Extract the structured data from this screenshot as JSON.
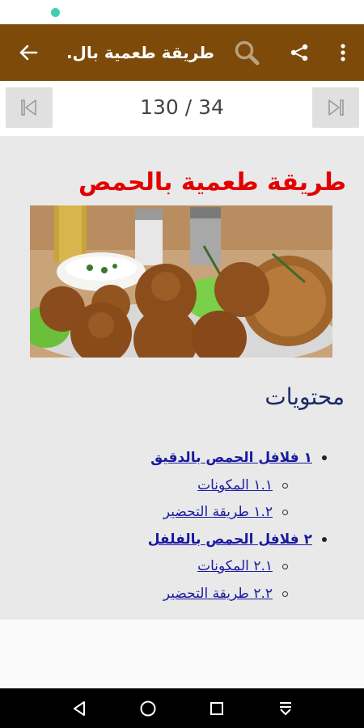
{
  "toolbar": {
    "title": "طريقة طعمية بال...",
    "back_icon": "arrow-back-icon",
    "search_icon": "search-icon",
    "share_icon": "share-icon",
    "menu_icon": "more-vert-icon",
    "color": "#7d4a0a"
  },
  "pager": {
    "counter": "130 / 34",
    "prev_icon": "skip-previous-icon",
    "next_icon": "skip-next-icon"
  },
  "article": {
    "title": "طريقة طعمية بالحمص",
    "title_color": "#e20000",
    "image": "falafel-photo"
  },
  "toc": {
    "heading": "محتويات",
    "items": [
      {
        "label": "١ فلافل الحمص بالدقيق",
        "level": 1
      },
      {
        "label": "١.١ المكونات",
        "level": 2
      },
      {
        "label": "١.٢ طريقة التحضير",
        "level": 2
      },
      {
        "label": "٢ فلافل الحمص بالفلفل",
        "level": 1
      },
      {
        "label": "٢.١ المكونات",
        "level": 2
      },
      {
        "label": "٢.٢ طريقة التحضير",
        "level": 2
      }
    ]
  },
  "navbar": {
    "back_icon": "nav-back-icon",
    "home_icon": "nav-home-icon",
    "recents_icon": "nav-recents-icon",
    "notification_icon": "nav-pull-down-icon"
  }
}
